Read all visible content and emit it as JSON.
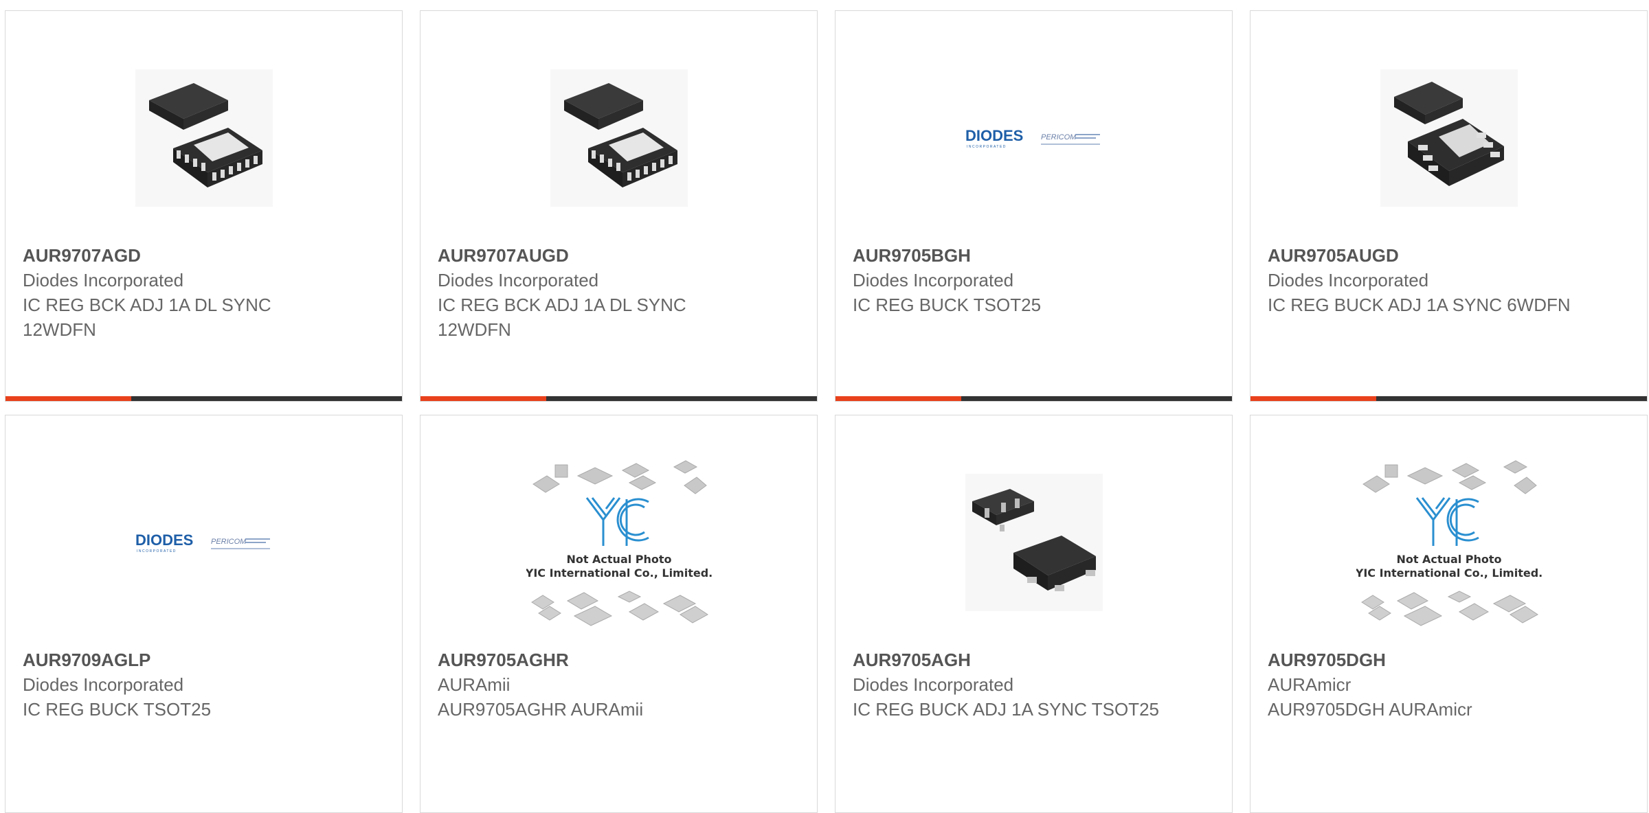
{
  "products": [
    {
      "part": "AUR9707AGD",
      "manufacturer": "Diodes Incorporated",
      "description": "IC REG BCK ADJ 1A DL SYNC 12WDFN",
      "image": "wdfn12-chip-icon"
    },
    {
      "part": "AUR9707AUGD",
      "manufacturer": "Diodes Incorporated",
      "description": "IC REG BCK ADJ 1A DL SYNC 12WDFN",
      "image": "wdfn12-chip-icon"
    },
    {
      "part": "AUR9705BGH",
      "manufacturer": "Diodes Incorporated",
      "description": "IC REG BUCK TSOT25",
      "image": "diodes-pericom-logo"
    },
    {
      "part": "AUR9705AUGD",
      "manufacturer": "Diodes Incorporated",
      "description": "IC REG BUCK ADJ 1A SYNC 6WDFN",
      "image": "wdfn6-chip-icon"
    },
    {
      "part": "AUR9709AGLP",
      "manufacturer": "Diodes Incorporated",
      "description": "IC REG BUCK TSOT25",
      "image": "diodes-pericom-logo"
    },
    {
      "part": "AUR9705AGHR",
      "manufacturer": "AURAmii",
      "description": "AUR9705AGHR AURAmii",
      "image": "yic-placeholder"
    },
    {
      "part": "AUR9705AGH",
      "manufacturer": "Diodes Incorporated",
      "description": "IC REG BUCK ADJ 1A SYNC TSOT25",
      "image": "tsot25-chip-icon"
    },
    {
      "part": "AUR9705DGH",
      "manufacturer": "AURAmicr",
      "description": "AUR9705DGH AURAmicr",
      "image": "yic-placeholder"
    }
  ],
  "logo": {
    "brand": "DIODES",
    "brand_sub": "INCORPORATED",
    "partner": "PERICOM"
  },
  "placeholder": {
    "brand": "YIC",
    "line1": "Not Actual Photo",
    "line2": "YIC International Co., Limited."
  },
  "colors": {
    "accent": "#e8411b",
    "bar": "#333333",
    "border": "#d9d9d9"
  }
}
